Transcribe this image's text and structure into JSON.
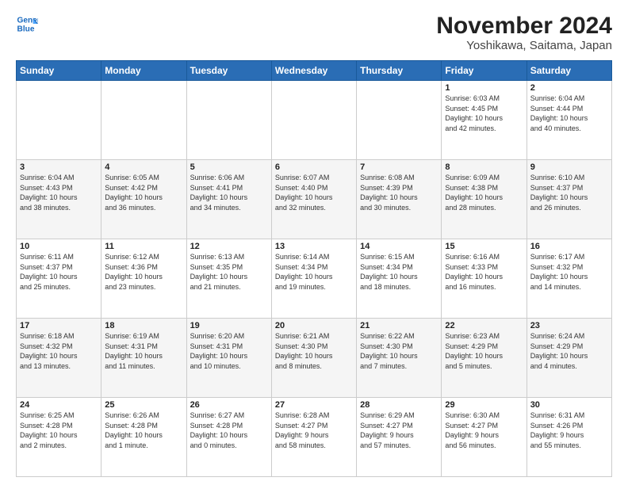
{
  "header": {
    "logo_line1": "General",
    "logo_line2": "Blue",
    "title": "November 2024",
    "subtitle": "Yoshikawa, Saitama, Japan"
  },
  "weekdays": [
    "Sunday",
    "Monday",
    "Tuesday",
    "Wednesday",
    "Thursday",
    "Friday",
    "Saturday"
  ],
  "weeks": [
    [
      {
        "day": "",
        "info": ""
      },
      {
        "day": "",
        "info": ""
      },
      {
        "day": "",
        "info": ""
      },
      {
        "day": "",
        "info": ""
      },
      {
        "day": "",
        "info": ""
      },
      {
        "day": "1",
        "info": "Sunrise: 6:03 AM\nSunset: 4:45 PM\nDaylight: 10 hours\nand 42 minutes."
      },
      {
        "day": "2",
        "info": "Sunrise: 6:04 AM\nSunset: 4:44 PM\nDaylight: 10 hours\nand 40 minutes."
      }
    ],
    [
      {
        "day": "3",
        "info": "Sunrise: 6:04 AM\nSunset: 4:43 PM\nDaylight: 10 hours\nand 38 minutes."
      },
      {
        "day": "4",
        "info": "Sunrise: 6:05 AM\nSunset: 4:42 PM\nDaylight: 10 hours\nand 36 minutes."
      },
      {
        "day": "5",
        "info": "Sunrise: 6:06 AM\nSunset: 4:41 PM\nDaylight: 10 hours\nand 34 minutes."
      },
      {
        "day": "6",
        "info": "Sunrise: 6:07 AM\nSunset: 4:40 PM\nDaylight: 10 hours\nand 32 minutes."
      },
      {
        "day": "7",
        "info": "Sunrise: 6:08 AM\nSunset: 4:39 PM\nDaylight: 10 hours\nand 30 minutes."
      },
      {
        "day": "8",
        "info": "Sunrise: 6:09 AM\nSunset: 4:38 PM\nDaylight: 10 hours\nand 28 minutes."
      },
      {
        "day": "9",
        "info": "Sunrise: 6:10 AM\nSunset: 4:37 PM\nDaylight: 10 hours\nand 26 minutes."
      }
    ],
    [
      {
        "day": "10",
        "info": "Sunrise: 6:11 AM\nSunset: 4:37 PM\nDaylight: 10 hours\nand 25 minutes."
      },
      {
        "day": "11",
        "info": "Sunrise: 6:12 AM\nSunset: 4:36 PM\nDaylight: 10 hours\nand 23 minutes."
      },
      {
        "day": "12",
        "info": "Sunrise: 6:13 AM\nSunset: 4:35 PM\nDaylight: 10 hours\nand 21 minutes."
      },
      {
        "day": "13",
        "info": "Sunrise: 6:14 AM\nSunset: 4:34 PM\nDaylight: 10 hours\nand 19 minutes."
      },
      {
        "day": "14",
        "info": "Sunrise: 6:15 AM\nSunset: 4:34 PM\nDaylight: 10 hours\nand 18 minutes."
      },
      {
        "day": "15",
        "info": "Sunrise: 6:16 AM\nSunset: 4:33 PM\nDaylight: 10 hours\nand 16 minutes."
      },
      {
        "day": "16",
        "info": "Sunrise: 6:17 AM\nSunset: 4:32 PM\nDaylight: 10 hours\nand 14 minutes."
      }
    ],
    [
      {
        "day": "17",
        "info": "Sunrise: 6:18 AM\nSunset: 4:32 PM\nDaylight: 10 hours\nand 13 minutes."
      },
      {
        "day": "18",
        "info": "Sunrise: 6:19 AM\nSunset: 4:31 PM\nDaylight: 10 hours\nand 11 minutes."
      },
      {
        "day": "19",
        "info": "Sunrise: 6:20 AM\nSunset: 4:31 PM\nDaylight: 10 hours\nand 10 minutes."
      },
      {
        "day": "20",
        "info": "Sunrise: 6:21 AM\nSunset: 4:30 PM\nDaylight: 10 hours\nand 8 minutes."
      },
      {
        "day": "21",
        "info": "Sunrise: 6:22 AM\nSunset: 4:30 PM\nDaylight: 10 hours\nand 7 minutes."
      },
      {
        "day": "22",
        "info": "Sunrise: 6:23 AM\nSunset: 4:29 PM\nDaylight: 10 hours\nand 5 minutes."
      },
      {
        "day": "23",
        "info": "Sunrise: 6:24 AM\nSunset: 4:29 PM\nDaylight: 10 hours\nand 4 minutes."
      }
    ],
    [
      {
        "day": "24",
        "info": "Sunrise: 6:25 AM\nSunset: 4:28 PM\nDaylight: 10 hours\nand 2 minutes."
      },
      {
        "day": "25",
        "info": "Sunrise: 6:26 AM\nSunset: 4:28 PM\nDaylight: 10 hours\nand 1 minute."
      },
      {
        "day": "26",
        "info": "Sunrise: 6:27 AM\nSunset: 4:28 PM\nDaylight: 10 hours\nand 0 minutes."
      },
      {
        "day": "27",
        "info": "Sunrise: 6:28 AM\nSunset: 4:27 PM\nDaylight: 9 hours\nand 58 minutes."
      },
      {
        "day": "28",
        "info": "Sunrise: 6:29 AM\nSunset: 4:27 PM\nDaylight: 9 hours\nand 57 minutes."
      },
      {
        "day": "29",
        "info": "Sunrise: 6:30 AM\nSunset: 4:27 PM\nDaylight: 9 hours\nand 56 minutes."
      },
      {
        "day": "30",
        "info": "Sunrise: 6:31 AM\nSunset: 4:26 PM\nDaylight: 9 hours\nand 55 minutes."
      }
    ]
  ]
}
